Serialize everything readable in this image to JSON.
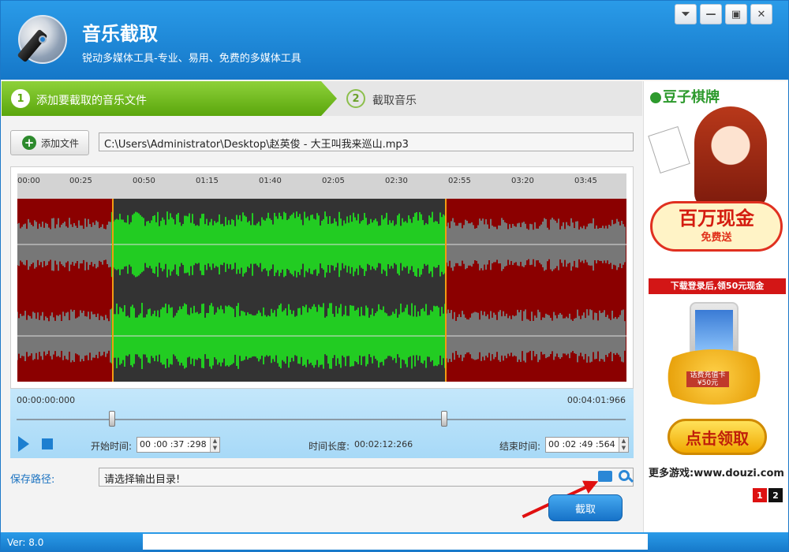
{
  "app": {
    "title": "音乐截取",
    "subtitle": "锐动多媒体工具-专业、易用、免费的多媒体工具",
    "window_buttons": [
      "menu-icon",
      "minimize-icon",
      "maximize-icon",
      "close-icon"
    ],
    "window_glyphs": {
      "menu": "⏷",
      "minimize": "—",
      "maximize": "▣",
      "close": "✕"
    }
  },
  "steps": [
    {
      "number": "1",
      "label": "添加要截取的音乐文件",
      "active": true
    },
    {
      "number": "2",
      "label": "截取音乐",
      "active": false
    }
  ],
  "file": {
    "add_button_label": "添加文件",
    "path": "C:\\Users\\Administrator\\Desktop\\赵英俊 - 大王叫我来巡山.mp3"
  },
  "waveform": {
    "ruler_ticks": [
      "00:00",
      "00:25",
      "00:50",
      "01:15",
      "01:40",
      "02:05",
      "02:30",
      "02:55",
      "03:20",
      "03:45"
    ],
    "colors": {
      "unselected": "#8b0000",
      "selected": "#333333",
      "wave_selected": "#22cc22",
      "wave_unselected": "#777777",
      "marker": "#f39c12"
    }
  },
  "timeline": {
    "start_time": "00:00:00:000",
    "end_time": "00:04:01:966",
    "start_label": "开始时间:",
    "start_value": "00 :00 :37 :298",
    "duration_label": "时间长度:",
    "duration_value": "00:02:12:266",
    "end_label": "结束时间:",
    "end_value": "00 :02 :49 :564"
  },
  "save": {
    "label": "保存路径:",
    "placeholder": "请选择输出目录!"
  },
  "cut_button": "截取",
  "status": {
    "version": "Ver: 8.0"
  },
  "ad": {
    "brand": "豆子棋牌",
    "promo_headline": "百万现金",
    "promo_sub": "免费送",
    "promo_banner": "下载登录后,领50元现金",
    "coupon_top": "话费充值卡",
    "coupon_value": "¥50元",
    "claim_button": "点击领取",
    "more_games": "更多游戏:www.douzi.com",
    "pages": [
      "1",
      "2"
    ]
  }
}
